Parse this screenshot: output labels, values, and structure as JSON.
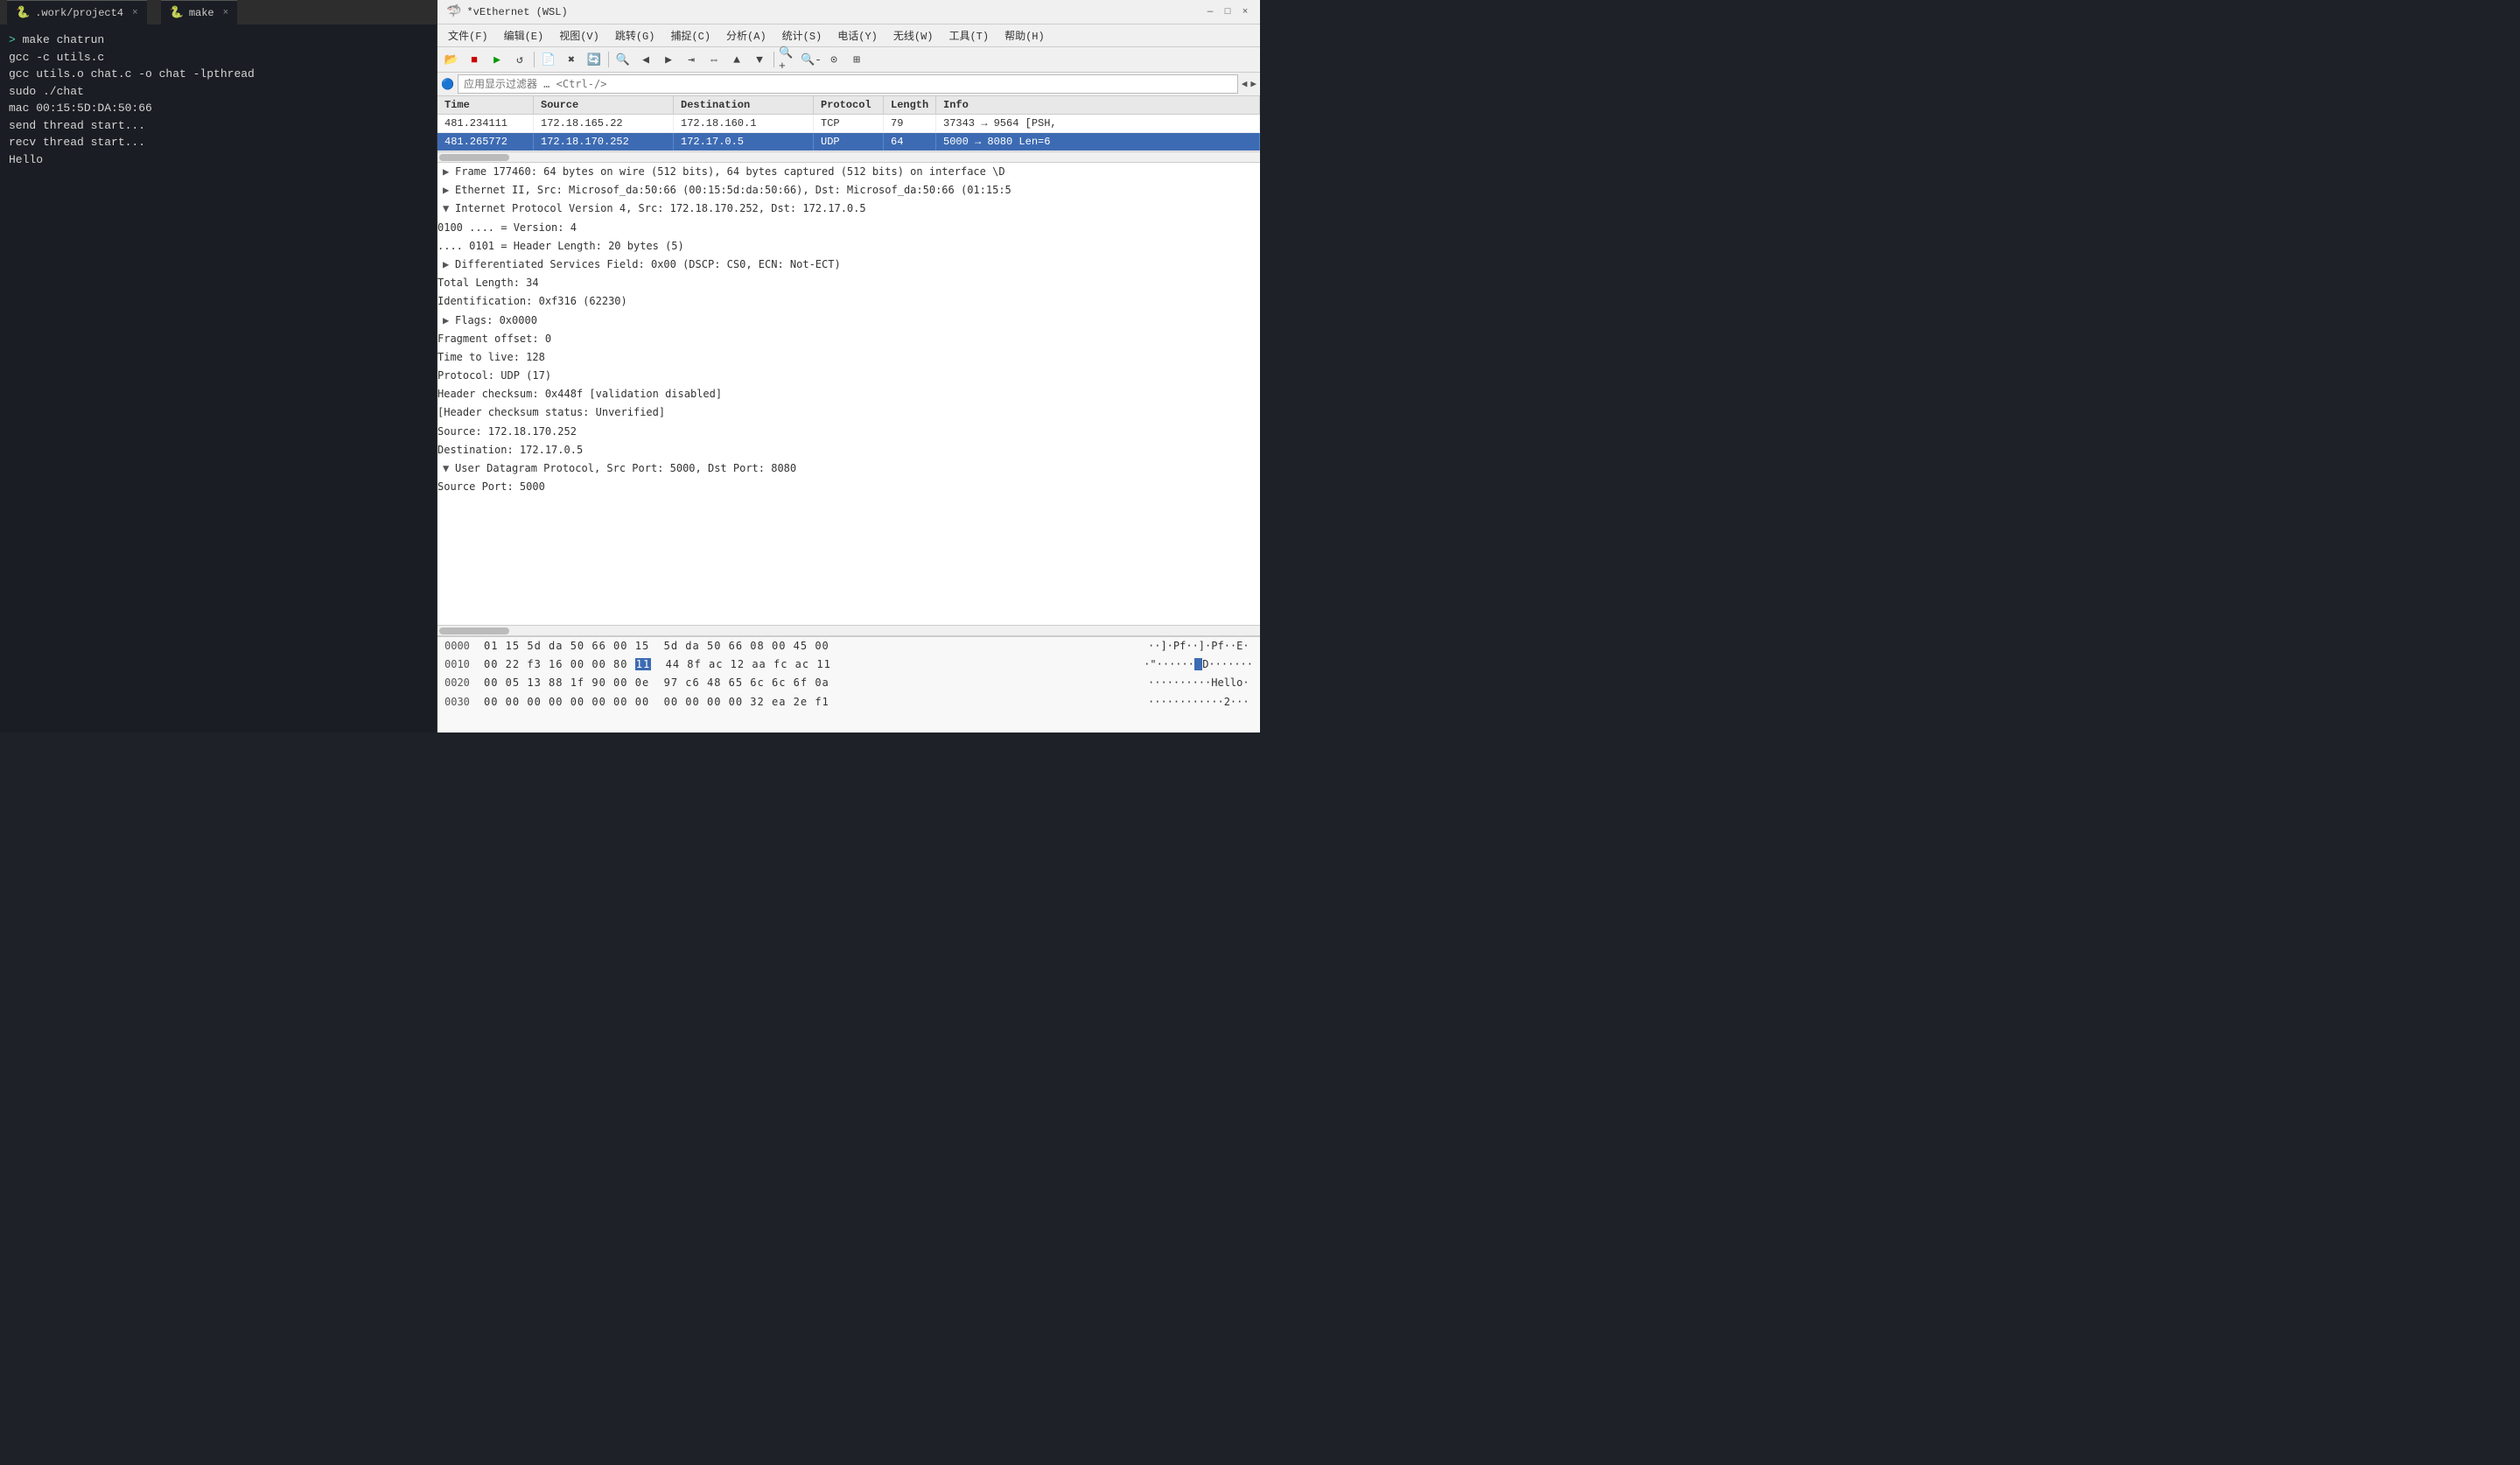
{
  "terminal": {
    "tab1": {
      "icon": "🐍",
      "title": ".work/project4",
      "close": "×"
    },
    "tab2": {
      "icon": "🐍",
      "title": "make",
      "close": "×"
    },
    "lines": [
      {
        "type": "prompt",
        "text": "> make chatrun"
      },
      {
        "type": "cmd",
        "text": "gcc -c utils.c"
      },
      {
        "type": "cmd",
        "text": "gcc utils.o  chat.c -o chat -lpthread"
      },
      {
        "type": "cmd",
        "text": "sudo ./chat"
      },
      {
        "type": "cmd",
        "text": "mac 00:15:5D:DA:50:66"
      },
      {
        "type": "cmd",
        "text": "send thread start..."
      },
      {
        "type": "cmd",
        "text": "recv thread start..."
      },
      {
        "type": "cmd",
        "text": "Hello"
      }
    ]
  },
  "wireshark": {
    "title": "*vEthernet (WSL)",
    "menu": [
      "文件(F)",
      "编辑(E)",
      "视图(V)",
      "跳转(G)",
      "捕捉(C)",
      "分析(A)",
      "统计(S)",
      "电话(Y)",
      "无线(W)",
      "工具(T)",
      "帮助(H)"
    ],
    "filter_placeholder": "应用显示过滤器 … <Ctrl-/>",
    "packet_list": {
      "columns": [
        "Time",
        "Source",
        "Destination",
        "Protocol",
        "Length",
        "Info"
      ],
      "rows": [
        {
          "time": "481.234111",
          "source": "172.18.165.22",
          "destination": "172.18.160.1",
          "protocol": "TCP",
          "length": "79",
          "info": "37343 → 9564 [PSH,",
          "selected": false
        },
        {
          "time": "481.265772",
          "source": "172.18.170.252",
          "destination": "172.17.0.5",
          "protocol": "UDP",
          "length": "64",
          "info": "5000 → 8080 Len=6",
          "selected": true
        }
      ]
    },
    "packet_details": [
      {
        "level": 0,
        "type": "collapsed",
        "text": "Frame 177460: 64 bytes on wire (512 bits), 64 bytes captured (512 bits) on interface \\D"
      },
      {
        "level": 0,
        "type": "collapsed",
        "text": "Ethernet II, Src: Microsof_da:50:66 (00:15:5d:da:50:66), Dst: Microsof_da:50:66 (01:15:5"
      },
      {
        "level": 0,
        "type": "expanded",
        "text": "Internet Protocol Version 4, Src: 172.18.170.252, Dst: 172.17.0.5"
      },
      {
        "level": 1,
        "type": "plain",
        "text": "0100 .... = Version: 4"
      },
      {
        "level": 1,
        "type": "plain",
        "text": ".... 0101 = Header Length: 20 bytes (5)"
      },
      {
        "level": 1,
        "type": "collapsed",
        "text": "Differentiated Services Field: 0x00 (DSCP: CS0, ECN: Not-ECT)"
      },
      {
        "level": 1,
        "type": "plain",
        "text": "Total Length: 34"
      },
      {
        "level": 1,
        "type": "plain",
        "text": "Identification: 0xf316 (62230)"
      },
      {
        "level": 1,
        "type": "collapsed",
        "text": "Flags: 0x0000"
      },
      {
        "level": 1,
        "type": "plain",
        "text": "Fragment offset: 0"
      },
      {
        "level": 1,
        "type": "plain",
        "text": "Time to live: 128"
      },
      {
        "level": 1,
        "type": "plain",
        "text": "Protocol: UDP (17)"
      },
      {
        "level": 1,
        "type": "plain",
        "text": "Header checksum: 0x448f [validation disabled]"
      },
      {
        "level": 1,
        "type": "plain",
        "text": "[Header checksum status: Unverified]"
      },
      {
        "level": 1,
        "type": "plain",
        "text": "Source: 172.18.170.252"
      },
      {
        "level": 1,
        "type": "plain",
        "text": "Destination: 172.17.0.5"
      },
      {
        "level": 0,
        "type": "expanded",
        "text": "User Datagram Protocol, Src Port: 5000, Dst Port: 8080"
      },
      {
        "level": 1,
        "type": "plain",
        "text": "Source Port: 5000"
      }
    ],
    "hex_dump": [
      {
        "offset": "0000",
        "bytes": "01 15 5d da 50 66 00 15  5d da 50 66 08 00 45 00",
        "ascii": "·]·Pf··]·Pf··E·"
      },
      {
        "offset": "0010",
        "bytes": "00 22 f3 16 00 00 80 11  44 8f ac 12 aa fc ac 11",
        "ascii": "·\"······D·······",
        "highlight_byte": "11"
      },
      {
        "offset": "0020",
        "bytes": "00 05 13 88 1f 90 00 0e  97 c6 48 65 6c 6c 6f 0a",
        "ascii": "··········Hello·"
      },
      {
        "offset": "0030",
        "bytes": "00 00 00 00 00 00 00 00  00 00 00 00 32 ea 2e f1",
        "ascii": "············2···"
      }
    ]
  }
}
